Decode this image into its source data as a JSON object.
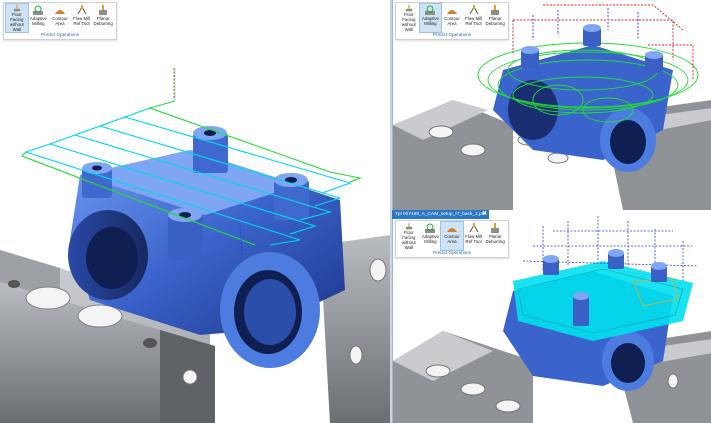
{
  "ribbon": {
    "group_label": "Predict Operations",
    "tools": [
      {
        "label": "Floor Facing\nwithout Wall",
        "icon": "floor-facing-icon"
      },
      {
        "label": "Adaptive\nMilling",
        "icon": "adaptive-milling-icon"
      },
      {
        "label": "Contour\nArea",
        "icon": "contour-area-icon"
      },
      {
        "label": "Flow Mill\nRef Tool",
        "icon": "flow-mill-icon"
      },
      {
        "label": "Planar\nDeburring",
        "icon": "planar-deburring-icon"
      }
    ]
  },
  "panes": {
    "main": {
      "active_tool": "Floor Facing without Wall"
    },
    "top_right": {
      "active_tool": "Adaptive Milling"
    },
    "bottom_right": {
      "active_tool": "Contour Area"
    }
  },
  "document_tab": {
    "title": "Tpl 007198_A_CAM_setup_IT_back_1.prt",
    "close": "✖"
  },
  "colors": {
    "part_blue": "#3f6fd3",
    "vise_gray": "#8a8d92",
    "toolpath_green": "#22dd33",
    "toolpath_cyan": "#00d8ee",
    "rapid_blue": "#2a3fd0",
    "rapid_red": "#e02020",
    "accent": "#2b78c6"
  }
}
